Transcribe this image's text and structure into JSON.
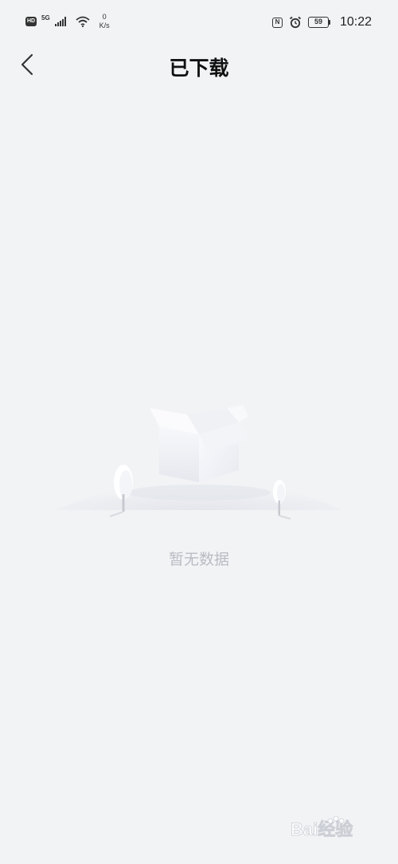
{
  "status_bar": {
    "hd_label": "HD",
    "network_type": "5G",
    "speed_value": "0",
    "speed_unit": "K/s",
    "nfc_label": "N",
    "battery_level": "59",
    "time": "10:22"
  },
  "header": {
    "title": "已下载",
    "back_icon": "chevron-left-icon"
  },
  "empty_state": {
    "message": "暂无数据",
    "illustration": "empty-box-illustration"
  },
  "watermark": {
    "text": "Bai经验"
  }
}
